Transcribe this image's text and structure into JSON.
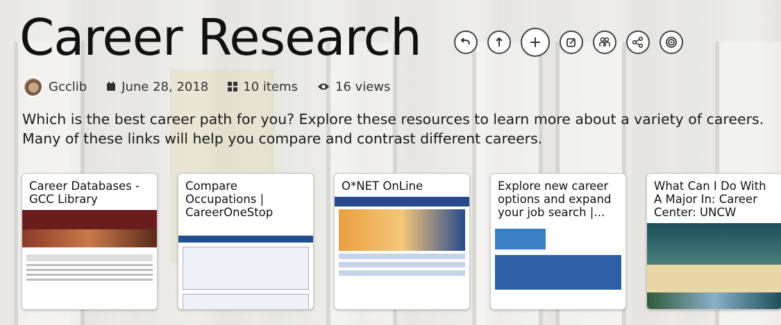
{
  "collection": {
    "title": "Career Research",
    "author": "Gcclib",
    "date": "June 28, 2018",
    "items": "10 items",
    "views": "16 views",
    "description": "Which is the best career path for you? Explore these resources to learn more about a variety of careers. Many of these links will help you compare and contrast different careers."
  },
  "actions": [
    {
      "icon": "back-arrow-icon"
    },
    {
      "icon": "up-arrow-icon"
    },
    {
      "icon": "plus-icon"
    },
    {
      "icon": "edit-icon"
    },
    {
      "icon": "collaborators-icon"
    },
    {
      "icon": "share-icon"
    },
    {
      "icon": "target-icon"
    }
  ],
  "cards": [
    {
      "title": "Career Databases - GCC Library"
    },
    {
      "title": "Compare Occupations | CareerOneStop"
    },
    {
      "title": "O*NET OnLine"
    },
    {
      "title": "Explore new career options and expand your job search |..."
    },
    {
      "title": "What Can I Do With A Major In: Career Center: UNCW"
    }
  ]
}
